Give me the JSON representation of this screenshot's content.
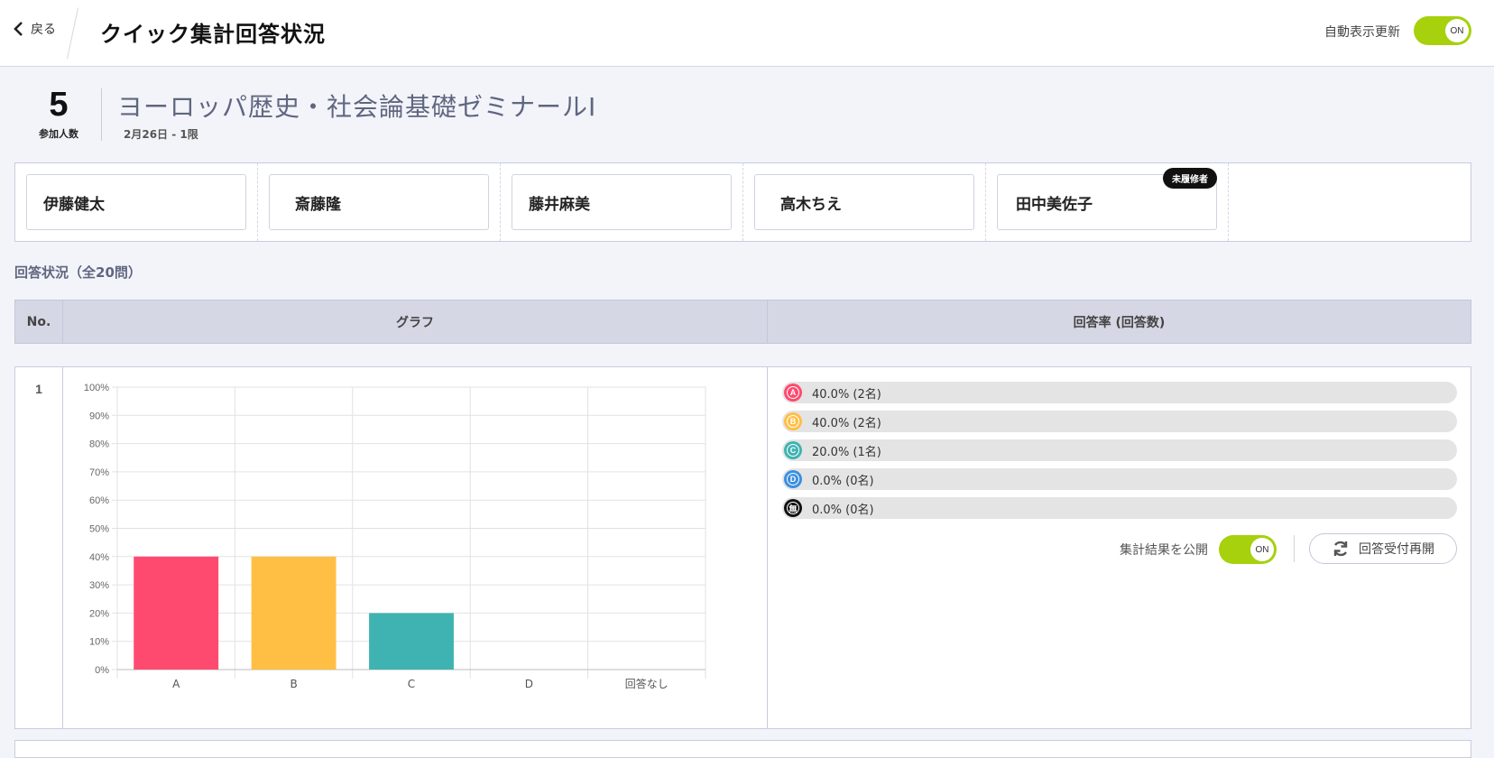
{
  "header": {
    "back_label": "戻る",
    "title": "クイック集計回答状況",
    "auto_update_label": "自動表示更新",
    "auto_update_state": "ON"
  },
  "class_info": {
    "participant_count": "5",
    "participant_label": "参加人数",
    "name": "ヨーロッパ歴史・社会論基礎ゼミナールⅠ",
    "date": "2月26日 - 1限"
  },
  "students": [
    {
      "name": "伊藤健太",
      "badge": ""
    },
    {
      "name": "斎藤隆",
      "badge": ""
    },
    {
      "name": "藤井麻美",
      "badge": ""
    },
    {
      "name": "高木ちえ",
      "badge": ""
    },
    {
      "name": "田中美佐子",
      "badge": "未履修者"
    }
  ],
  "section_title": "回答状況（全20問）",
  "table": {
    "col_no": "No.",
    "col_graph": "グラフ",
    "col_rate": "回答率 (回答数)"
  },
  "questions": [
    {
      "no": "1",
      "options": [
        {
          "key": "A",
          "percent": 40.0,
          "text": "40.0% (2名)",
          "color": "#ff4a6f"
        },
        {
          "key": "B",
          "percent": 40.0,
          "text": "40.0% (2名)",
          "color": "#ffbf44"
        },
        {
          "key": "C",
          "percent": 20.0,
          "text": "20.0% (1名)",
          "color": "#3fb3b2"
        },
        {
          "key": "D",
          "percent": 0.0,
          "text": "0.0% (0名)",
          "color": "#3a8fe0"
        },
        {
          "key": "無",
          "percent": 0.0,
          "text": "0.0% (0名)",
          "color": "#111111"
        }
      ],
      "publish_label": "集計結果を公開",
      "publish_state": "ON",
      "reopen_label": "回答受付再開"
    }
  ],
  "chart_data": {
    "type": "bar",
    "categories": [
      "A",
      "B",
      "C",
      "D",
      "回答なし"
    ],
    "values": [
      40,
      40,
      20,
      0,
      0
    ],
    "colors": [
      "#ff4a6f",
      "#ffbf44",
      "#3fb3b2",
      "#3a8fe0",
      "#111111"
    ],
    "title": "",
    "xlabel": "",
    "ylabel": "",
    "ylim": [
      0,
      100
    ],
    "yticks": [
      "0%",
      "10%",
      "20%",
      "30%",
      "40%",
      "50%",
      "60%",
      "70%",
      "80%",
      "90%",
      "100%"
    ],
    "grid": true
  }
}
